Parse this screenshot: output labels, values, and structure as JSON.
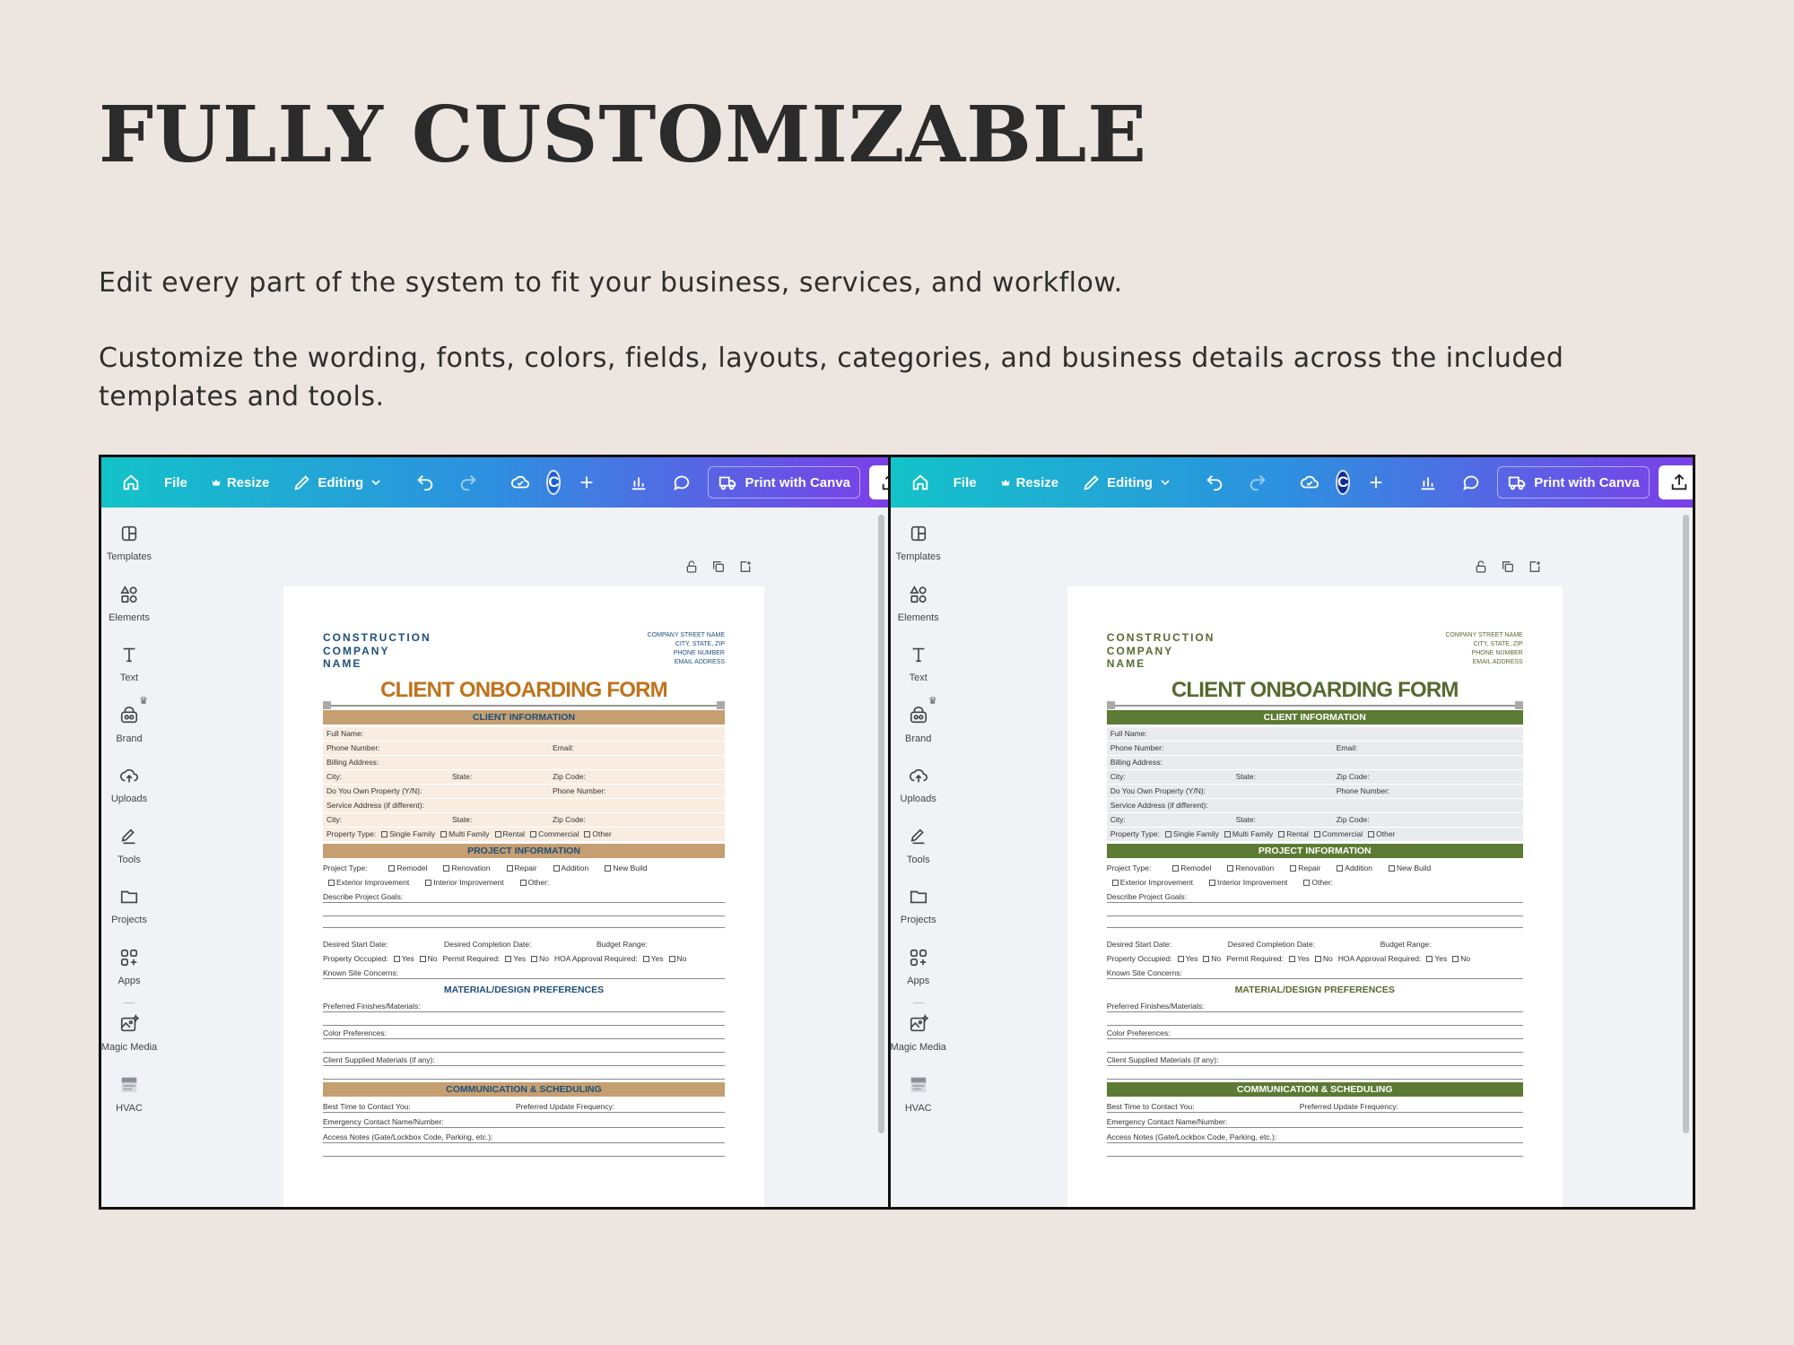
{
  "headline": "FULLY CUSTOMIZABLE",
  "paragraph1": "Edit every part of the system to fit your business, services, and workflow.",
  "paragraph2": "Customize the wording, fonts, colors, fields, layouts, categories, and business details across the included templates and tools.",
  "editor": {
    "toolbar": {
      "file": "File",
      "resize": "Resize",
      "editing": "Editing",
      "avatar": "C",
      "print": "Print with Canva",
      "share": "Share"
    },
    "sidebar": [
      {
        "label": "Templates",
        "icon": "templates-icon"
      },
      {
        "label": "Elements",
        "icon": "elements-icon"
      },
      {
        "label": "Text",
        "icon": "text-icon"
      },
      {
        "label": "Brand",
        "icon": "brand-icon"
      },
      {
        "label": "Uploads",
        "icon": "uploads-icon"
      },
      {
        "label": "Tools",
        "icon": "tools-icon"
      },
      {
        "label": "Projects",
        "icon": "projects-icon"
      },
      {
        "label": "Apps",
        "icon": "apps-icon"
      },
      {
        "label": "Magic Media",
        "icon": "magic-media-icon"
      },
      {
        "label": "HVAC",
        "icon": "hvac-icon"
      }
    ]
  },
  "form": {
    "company": [
      "CONSTRUCTION",
      "COMPANY",
      "NAME"
    ],
    "address": [
      "COMPANY STREET NAME",
      "CITY, STATE, ZIP",
      "PHONE NUMBER",
      "EMAIL ADDRESS"
    ],
    "title": "CLIENT ONBOARDING FORM",
    "client_info": "CLIENT INFORMATION",
    "full_name": "Full Name:",
    "phone": "Phone Number:",
    "email": "Email:",
    "billing": "Billing Address:",
    "city": "City:",
    "state": "State:",
    "zip": "Zip Code:",
    "own_property": "Do You Own Property (Y/N):",
    "service_address": "Service Address (if different):",
    "property_type": "Property Type:",
    "pt_options": [
      "Single Family",
      "Multi Family",
      "Rental",
      "Commercial",
      "Other"
    ],
    "project_info": "PROJECT INFORMATION",
    "project_type": "Project Type:",
    "proj_options": [
      "Remodel",
      "Renovation",
      "Repair",
      "Addition",
      "New Build"
    ],
    "proj_options2": [
      "Exterior Improvement",
      "Interior Improvement",
      "Other:"
    ],
    "describe_goals": "Describe Project Goals:",
    "start_date": "Desired Start Date:",
    "completion_date": "Desired Completion Date:",
    "budget": "Budget Range:",
    "property_occupied": "Property Occupied:",
    "permit": "Permit Required:",
    "hoa": "HOA Approval Required:",
    "yes": "Yes",
    "no": "No",
    "site_concerns": "Known Site Concerns:",
    "material_prefs": "MATERIAL/DESIGN PREFERENCES",
    "finishes": "Preferred Finishes/Materials:",
    "color_prefs": "Color Preferences:",
    "client_materials": "Client Supplied Materials (if any):",
    "communication": "COMMUNICATION & SCHEDULING",
    "best_time": "Best Time to Contact You:",
    "update_freq": "Preferred Update Frequency:",
    "emergency": "Emergency Contact Name/Number:",
    "access_notes": "Access Notes (Gate/Lockbox Code, Parking, etc.):"
  },
  "themes": {
    "left": {
      "band": "#c59f71",
      "band_text": "#1f4f7a",
      "title": "#c0721c",
      "accent": "#1e4e7c",
      "row": "#f9ece0"
    },
    "right": {
      "band": "#5b7a33",
      "band_text": "#ffffff",
      "title": "#556b2f",
      "accent": "#556b2f",
      "row": "#e9ecee"
    }
  }
}
